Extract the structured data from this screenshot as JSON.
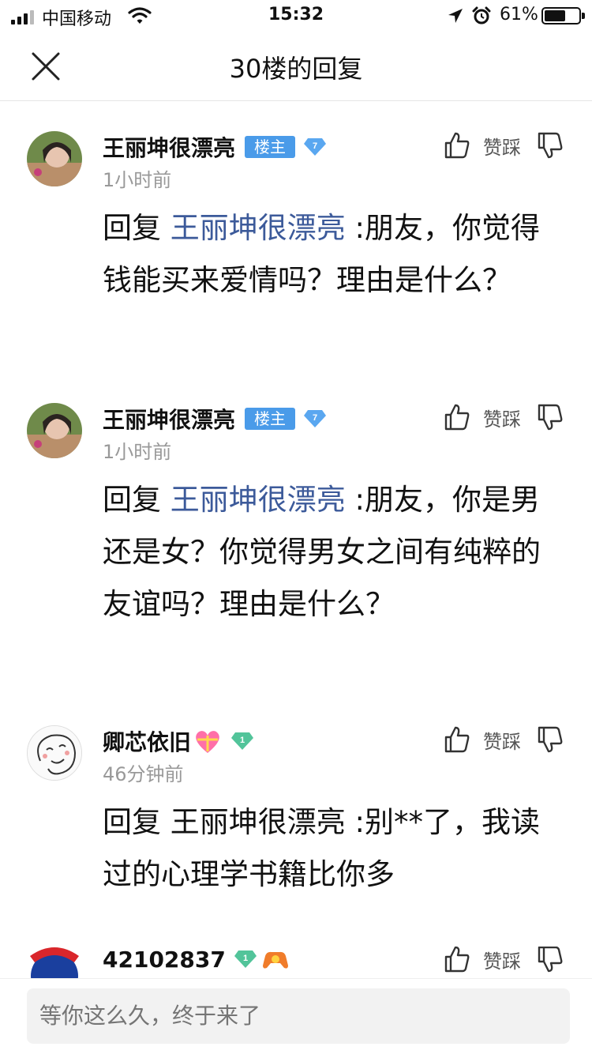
{
  "status_bar": {
    "carrier": "中国移动",
    "time": "15:32",
    "battery": "61%",
    "battery_level": 0.61
  },
  "nav": {
    "title": "30楼的回复",
    "close_icon": "close-icon"
  },
  "comments": [
    {
      "username": "王丽坤很漂亮",
      "host_badge": "楼主",
      "level": "7",
      "time": "1小时前",
      "like_label": "赞踩",
      "reply_prefix": "回复 ",
      "mention": "王丽坤很漂亮",
      "text": " :朋友，你觉得钱能买来爱情吗？理由是什么？"
    },
    {
      "username": "王丽坤很漂亮",
      "host_badge": "楼主",
      "level": "7",
      "time": "1小时前",
      "like_label": "赞踩",
      "reply_prefix": "回复 ",
      "mention": "王丽坤很漂亮",
      "text": " :朋友，你是男还是女？你觉得男女之间有纯粹的友谊吗？理由是什么？"
    },
    {
      "username": "卿芯依旧",
      "level": "1",
      "time": "46分钟前",
      "like_label": "赞踩",
      "text": "回复 王丽坤很漂亮 :别**了，我读过的心理学书籍比你多"
    },
    {
      "username": "42102837",
      "level": "1",
      "like_label": "赞踩"
    }
  ],
  "input": {
    "placeholder": "等你这么久，终于来了"
  },
  "colors": {
    "accent_blue": "#4a9be9",
    "mention_blue": "#3c5a9a",
    "level_blue": "#5aa7f0",
    "level_green": "#52c49a"
  }
}
